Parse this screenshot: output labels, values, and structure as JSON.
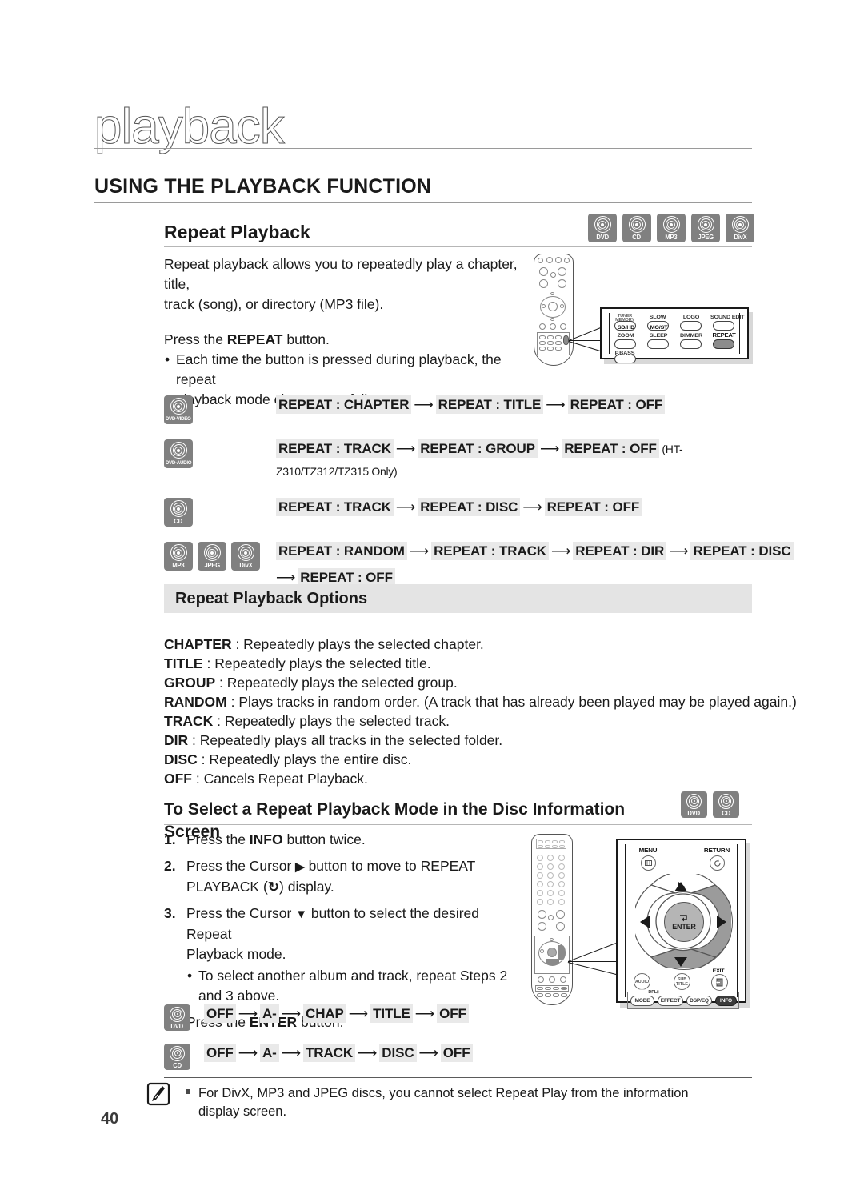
{
  "page": {
    "running_head": "playback",
    "page_number": "40",
    "section_title": "USING THE PLAYBACK FUNCTION"
  },
  "repeat_playback": {
    "heading": "Repeat Playback",
    "badges": [
      {
        "label": "DVD",
        "name": "dvd"
      },
      {
        "label": "CD",
        "name": "cd"
      },
      {
        "label": "MP3",
        "name": "mp3"
      },
      {
        "label": "JPEG",
        "name": "jpeg"
      },
      {
        "label": "DivX",
        "name": "divx"
      }
    ],
    "intro_1": "Repeat playback allows you to repeatedly play a chapter, title,",
    "intro_2": "track (song), or directory (MP3 file).",
    "press_pre": "Press the ",
    "press_bold": "REPEAT",
    "press_post": " button.",
    "bullet_1": "Each time the button is pressed during playback, the repeat",
    "bullet_2": "playback mode changes as follows:"
  },
  "sequences": [
    {
      "icons": [
        {
          "label": "DVD-VIDEO",
          "wide": true
        }
      ],
      "items": [
        "REPEAT : CHAPTER",
        "REPEAT : TITLE",
        "REPEAT : OFF"
      ],
      "suffix": ""
    },
    {
      "icons": [
        {
          "label": "DVD-AUDIO",
          "wide": true
        }
      ],
      "items": [
        "REPEAT : TRACK",
        "REPEAT : GROUP",
        "REPEAT : OFF"
      ],
      "suffix": "(HT-Z310/TZ312/TZ315 Only)"
    },
    {
      "icons": [
        {
          "label": "CD",
          "wide": false
        }
      ],
      "items": [
        "REPEAT : TRACK",
        "REPEAT : DISC",
        "REPEAT : OFF"
      ],
      "suffix": ""
    },
    {
      "icons": [
        {
          "label": "MP3",
          "wide": false
        },
        {
          "label": "JPEG",
          "wide": false
        },
        {
          "label": "DivX",
          "wide": false
        }
      ],
      "items": [
        "REPEAT : RANDOM",
        "REPEAT : TRACK",
        "REPEAT : DIR",
        "REPEAT : DISC"
      ],
      "continuation": [
        "REPEAT : OFF"
      ],
      "suffix": ""
    }
  ],
  "options": {
    "heading": "Repeat Playback Options",
    "items": [
      {
        "term": "CHAPTER",
        "desc": " : Repeatedly plays the selected chapter."
      },
      {
        "term": "TITLE",
        "desc": " : Repeatedly plays the selected title."
      },
      {
        "term": "GROUP",
        "desc": " : Repeatedly plays the selected group."
      },
      {
        "term": "RANDOM",
        "desc": " : Plays tracks in random order. (A track that has already been played may be played again.)"
      },
      {
        "term": "TRACK",
        "desc": " : Repeatedly plays the selected track."
      },
      {
        "term": "DIR",
        "desc": " : Repeatedly plays all tracks in the selected folder."
      },
      {
        "term": "DISC",
        "desc": " : Repeatedly plays the entire disc."
      },
      {
        "term": "OFF",
        "desc": " : Cancels Repeat Playback."
      }
    ]
  },
  "disc_info": {
    "heading": "To Select a Repeat Playback Mode in the Disc Information Screen",
    "badges": [
      {
        "label": "DVD",
        "name": "dvd"
      },
      {
        "label": "CD",
        "name": "cd"
      }
    ],
    "steps": [
      {
        "num": "1.",
        "pre": "Press the ",
        "bold": "INFO",
        "post": " button twice.",
        "line2": "",
        "sub": ""
      },
      {
        "num": "2.",
        "pre": "Press the Cursor ",
        "bold": "▶",
        "post": " button to move to REPEAT",
        "line2": "PLAYBACK (↻) display.",
        "sub": ""
      },
      {
        "num": "3.",
        "pre": "Press the Cursor ",
        "bold": "▼",
        "post": " button to select the desired Repeat",
        "line2": "Playback mode.",
        "sub": "To select another album and track, repeat Steps 2 and 3 above."
      },
      {
        "num": "4.",
        "pre": "Press the ",
        "bold": "ENTER",
        "post": " button.",
        "line2": "",
        "sub": ""
      }
    ]
  },
  "sequences_info": [
    {
      "icons": [
        {
          "label": "DVD",
          "wide": false
        }
      ],
      "items": [
        "OFF",
        "A-",
        "CHAP",
        "TITLE",
        "OFF"
      ]
    },
    {
      "icons": [
        {
          "label": "CD",
          "wide": false
        }
      ],
      "items": [
        "OFF",
        "A-",
        "TRACK",
        "DISC",
        "OFF"
      ]
    }
  ],
  "note": {
    "line1": "For DivX, MP3 and JPEG discs, you cannot select Repeat Play from the information",
    "line2": "display screen."
  },
  "remote_callout_top": {
    "buttons": [
      {
        "label": "SD/HD",
        "top_label_1": "TUNER",
        "top_label_2": "MEMORY",
        "selected": false
      },
      {
        "label": "MO/ST",
        "top_label_1": "SLOW",
        "top_label_2": "",
        "selected": false
      },
      {
        "label": "",
        "top_label_1": "LOGO",
        "top_label_2": "",
        "selected": false
      },
      {
        "label": "",
        "top_label_1": "SOUND EDIT",
        "top_label_2": "",
        "selected": false
      },
      {
        "label": "",
        "top_label_1": "ZOOM",
        "top_label_2": "",
        "selected": false
      },
      {
        "label": "",
        "top_label_1": "SLEEP",
        "top_label_2": "",
        "selected": false
      },
      {
        "label": "",
        "top_label_1": "DIMMER",
        "top_label_2": "",
        "selected": false
      },
      {
        "label": "",
        "top_label_1": "REPEAT",
        "top_label_2": "",
        "selected": true
      },
      {
        "label": "",
        "top_label_1": "P.BASS",
        "top_label_2": "",
        "selected": false
      }
    ]
  },
  "remote_callout_bottom": {
    "menu_label": "MENU",
    "return_label": "RETURN",
    "enter_label": "ENTER",
    "audio_label": "AUDIO",
    "subtitle_label_1": "SUB",
    "subtitle_label_2": "TITLE",
    "exit_label": "EXIT",
    "dplii_label": "DPLⅡ",
    "bottom_row": [
      {
        "label": "MODE",
        "selected": false
      },
      {
        "label": "EFFECT",
        "selected": false
      },
      {
        "label": "DSP/EQ",
        "selected": false
      },
      {
        "label": "INFO",
        "selected": true
      }
    ]
  },
  "colors": {
    "badge_gray": "#808080",
    "highlight_gray": "#e9e9e9",
    "bar_gray": "#e4e4e4",
    "selected_button": "#8c8c8c"
  }
}
